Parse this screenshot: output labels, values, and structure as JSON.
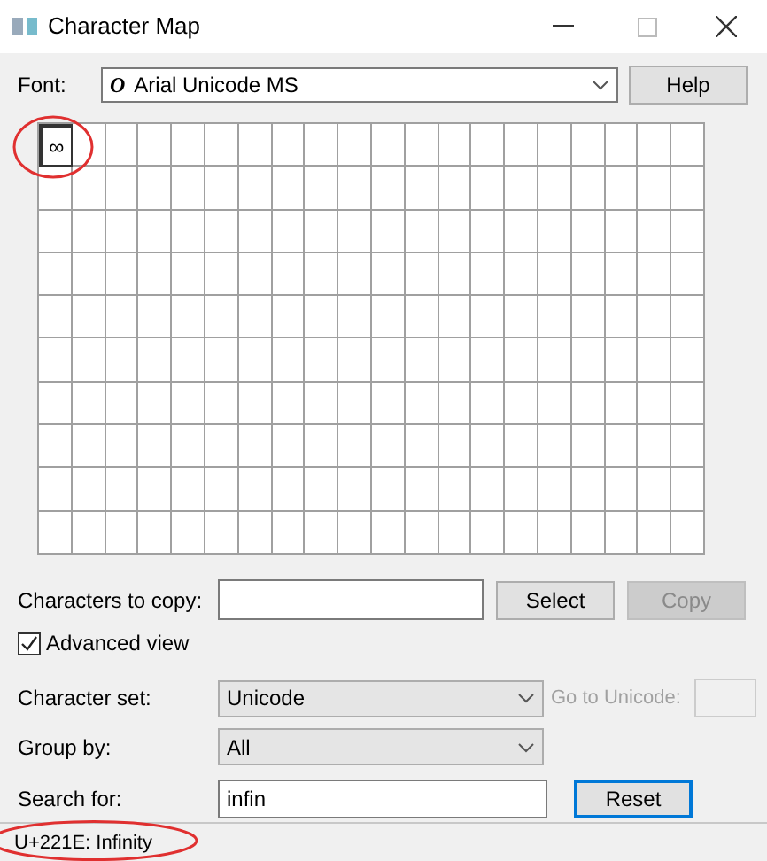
{
  "window": {
    "title": "Character Map"
  },
  "font": {
    "label": "Font:",
    "value": "Arial Unicode MS",
    "glyph": "O"
  },
  "help_button": "Help",
  "grid": {
    "cells": [
      {
        "char": "∞",
        "selected": true
      }
    ]
  },
  "copy": {
    "label": "Characters to copy:",
    "select_button": "Select",
    "copy_button": {
      "label": "Copy",
      "disabled": true
    }
  },
  "advanced_view": {
    "label": "Advanced view",
    "checked": true
  },
  "character_set": {
    "label": "Character set:",
    "value": "Unicode"
  },
  "go_to_unicode": {
    "label": "Go to Unicode:",
    "disabled": true
  },
  "group_by": {
    "label": "Group by:",
    "value": "All"
  },
  "search": {
    "label": "Search for:",
    "value": "infin",
    "reset_button": "Reset"
  },
  "status_bar": "U+221E: Infinity"
}
